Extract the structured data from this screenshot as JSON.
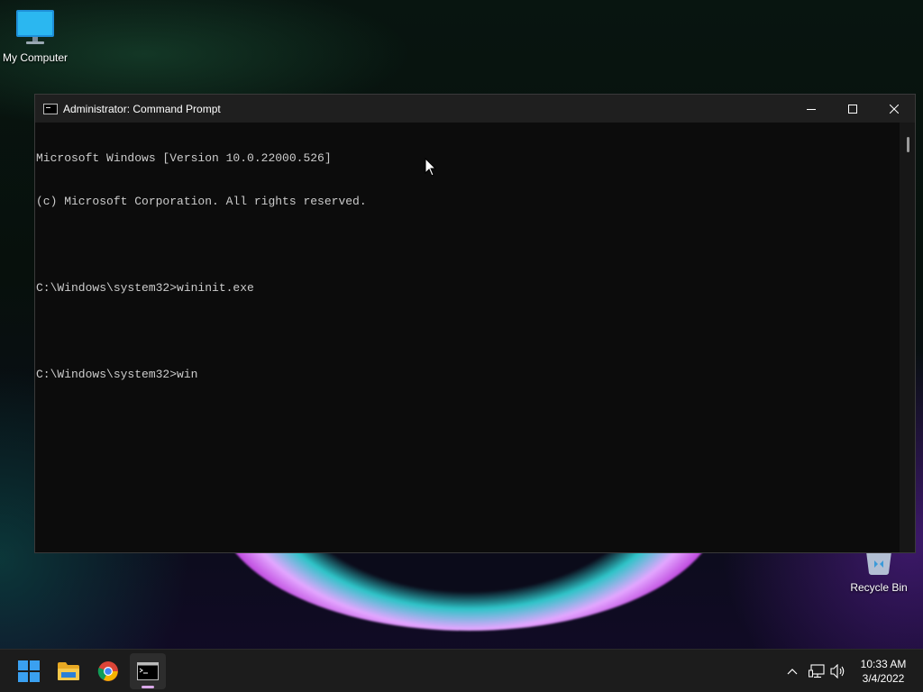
{
  "desktop": {
    "icons": [
      {
        "label": "My Computer",
        "icon": "monitor-icon"
      },
      {
        "label": "Recycle Bin",
        "icon": "recycle-bin-icon"
      }
    ]
  },
  "window": {
    "title": "Administrator: Command Prompt",
    "icon": "command-prompt-icon",
    "controls": {
      "minimize": "minimize-icon",
      "maximize": "maximize-icon",
      "close": "close-icon"
    }
  },
  "console": {
    "lines": [
      "Microsoft Windows [Version 10.0.22000.526]",
      "(c) Microsoft Corporation. All rights reserved.",
      "",
      "C:\\Windows\\system32>wininit.exe",
      "",
      "C:\\Windows\\system32>win"
    ]
  },
  "taskbar": {
    "apps": [
      {
        "name": "Start",
        "icon": "windows-start-icon"
      },
      {
        "name": "File Explorer",
        "icon": "folder-icon"
      },
      {
        "name": "Google Chrome",
        "icon": "chrome-icon"
      },
      {
        "name": "Command Prompt",
        "icon": "command-prompt-icon",
        "active": true
      }
    ],
    "tray": {
      "icons": [
        "chevron-up-icon",
        "network-icon",
        "volume-icon"
      ],
      "time": "10:33 AM",
      "date": "3/4/2022"
    }
  },
  "colors": {
    "console_bg": "#0c0c0c",
    "console_text": "#cccccc",
    "titlebar_bg": "#1f1f1f",
    "taskbar_bg": "#1c1c1c",
    "start_blue": "#3aa0f0",
    "active_indicator": "#d9a8e8"
  }
}
